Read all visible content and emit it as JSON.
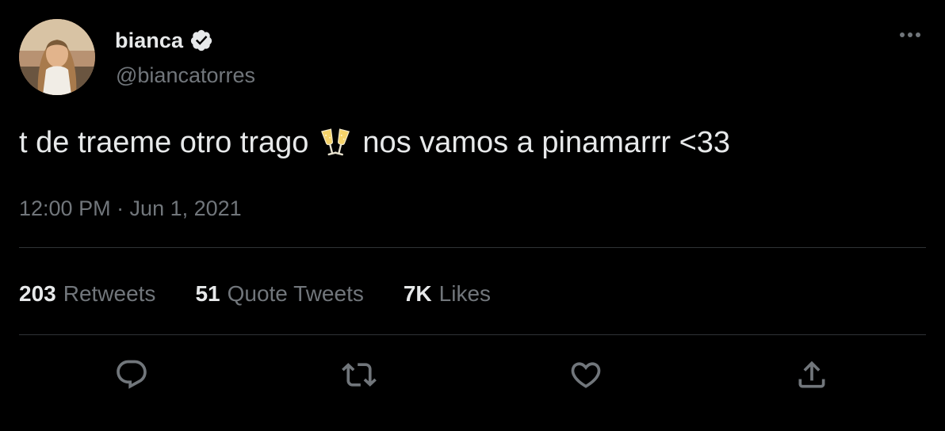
{
  "user": {
    "display_name": "bianca",
    "handle": "@biancatorres",
    "verified": true
  },
  "tweet": {
    "text_before_emoji": "t de traeme otro trago",
    "emoji": "clinking-glasses",
    "text_after_emoji": "nos vamos a pinamarrr <33",
    "timestamp": "12:00 PM · Jun 1, 2021"
  },
  "stats": [
    {
      "count": "203",
      "label": "Retweets"
    },
    {
      "count": "51",
      "label": "Quote Tweets"
    },
    {
      "count": "7K",
      "label": "Likes"
    }
  ],
  "actions": {
    "reply_icon": "reply-icon",
    "retweet_icon": "retweet-icon",
    "like_icon": "heart-icon",
    "share_icon": "share-icon"
  },
  "colors": {
    "background": "#000000",
    "primary_text": "#e7e9ea",
    "secondary_text": "#71767b",
    "divider": "#2f3336"
  }
}
